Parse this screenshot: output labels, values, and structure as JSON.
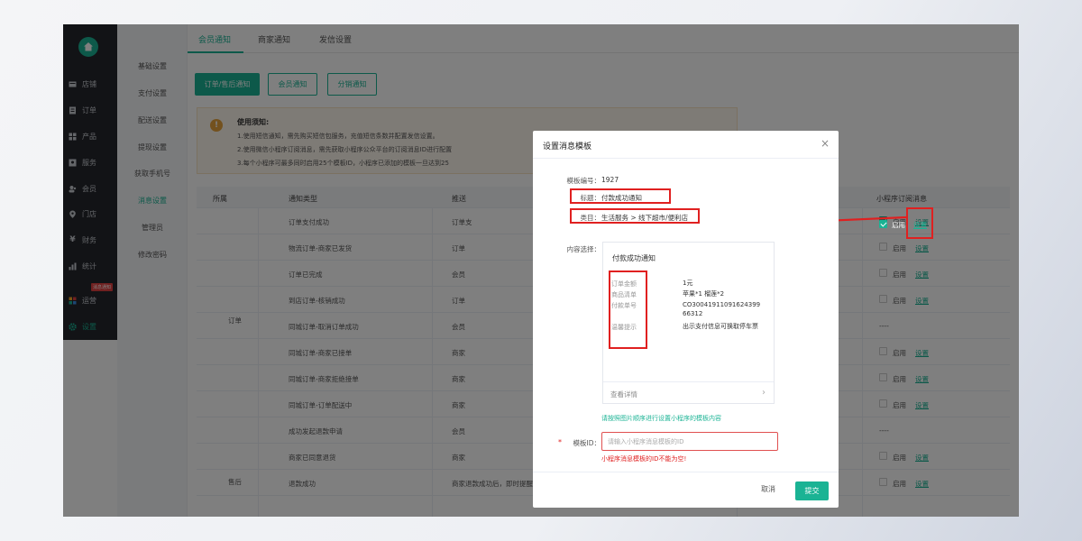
{
  "sidebar": {
    "items": [
      {
        "label": "店铺",
        "icon": "store-icon"
      },
      {
        "label": "订单",
        "icon": "order-icon"
      },
      {
        "label": "产品",
        "icon": "product-icon"
      },
      {
        "label": "服务",
        "icon": "service-icon"
      },
      {
        "label": "会员",
        "icon": "member-icon"
      },
      {
        "label": "门店",
        "icon": "location-icon"
      },
      {
        "label": "财务",
        "icon": "finance-icon"
      },
      {
        "label": "统计",
        "icon": "stats-icon"
      },
      {
        "label": "运营",
        "icon": "operations-icon"
      },
      {
        "label": "设置",
        "icon": "settings-icon"
      }
    ],
    "badge": "消息通知"
  },
  "submenu": {
    "items": [
      "基础设置",
      "支付设置",
      "配送设置",
      "提现设置",
      "获取手机号",
      "消息设置",
      "管理员",
      "修改密码"
    ]
  },
  "tabs": [
    "会员通知",
    "商家通知",
    "发信设置"
  ],
  "buttons": [
    "订单/售后通知",
    "会员通知",
    "分销通知"
  ],
  "notice": {
    "title": "使用须知:",
    "lines": [
      "1.使用短信通知，需先购买短信包服务，充值短信条数并配置发信设置。",
      "2.使用微信小程序订阅消息，需先获取小程序公众平台的订阅消息ID进行配置",
      "3.每个小程序可最多同时启用25个模板ID，小程序已添加的模板一旦达到25"
    ]
  },
  "table": {
    "headers": [
      "所属",
      "通知类型",
      "推送",
      "小程序订阅消息"
    ],
    "groups": [
      "订单",
      "售后"
    ],
    "rows": [
      {
        "type": "订单支付成功",
        "push": "订单支",
        "checked": true,
        "enable": "启用",
        "set": "设置"
      },
      {
        "type": "物流订单-商家已发货",
        "push": "订单",
        "checked": false,
        "enable": "启用",
        "set": "设置"
      },
      {
        "type": "订单已完成",
        "push": "会员",
        "checked": false,
        "enable": "启用",
        "set": "设置"
      },
      {
        "type": "到店订单-核销成功",
        "push": "订单",
        "checked": false,
        "enable": "启用",
        "set": "设置"
      },
      {
        "type": "同城订单-取消订单成功",
        "push": "会员",
        "checked": null,
        "enable": "----",
        "set": ""
      },
      {
        "type": "同城订单-商家已接单",
        "push": "商家",
        "checked": false,
        "enable": "启用",
        "set": "设置"
      },
      {
        "type": "同城订单-商家拒绝接单",
        "push": "商家",
        "checked": false,
        "enable": "启用",
        "set": "设置"
      },
      {
        "type": "同城订单-订单配送中",
        "push": "商家",
        "checked": false,
        "enable": "启用",
        "set": "设置"
      },
      {
        "type": "成功发起退款申请",
        "push": "会员",
        "checked": null,
        "enable": "----",
        "set": ""
      },
      {
        "type": "商家已同意退货",
        "push": "商家",
        "checked": false,
        "enable": "启用",
        "set": "设置"
      },
      {
        "type": "退款成功",
        "push": "商家退款成功后，即时提醒",
        "checked": false,
        "enable": "启用",
        "set": "设置",
        "extra_enable": "启用"
      }
    ]
  },
  "modal": {
    "title": "设置消息模板",
    "template_no_label": "模板编号：",
    "template_no": "1927",
    "title_label": "标题：",
    "title_value": "付款成功通知",
    "category_label": "类目：",
    "category_value": "生活服务 > 线下超市/便利店",
    "content_label": "内容选择：",
    "preview": {
      "title": "付款成功通知",
      "fields": [
        {
          "label": "订单金额",
          "value": "1元"
        },
        {
          "label": "商品清单",
          "value": "苹果*1 榴莲*2"
        },
        {
          "label": "付款单号",
          "value": "CO30041911091624399 66312"
        },
        {
          "label": "温馨提示",
          "value": "出示支付信息可换取停车票"
        }
      ],
      "footer": "查看详情"
    },
    "hint": "请按照图片顺序进行设置小程序的模板内容",
    "id_label": "模板ID：",
    "id_placeholder": "请输入小程序消息模板的ID",
    "error": "小程序消息模板的ID不能为空!",
    "cancel": "取消",
    "submit": "提交"
  },
  "colors": {
    "accent": "#1ab394",
    "error": "#e02020",
    "sidebar_bg": "#24272c"
  }
}
